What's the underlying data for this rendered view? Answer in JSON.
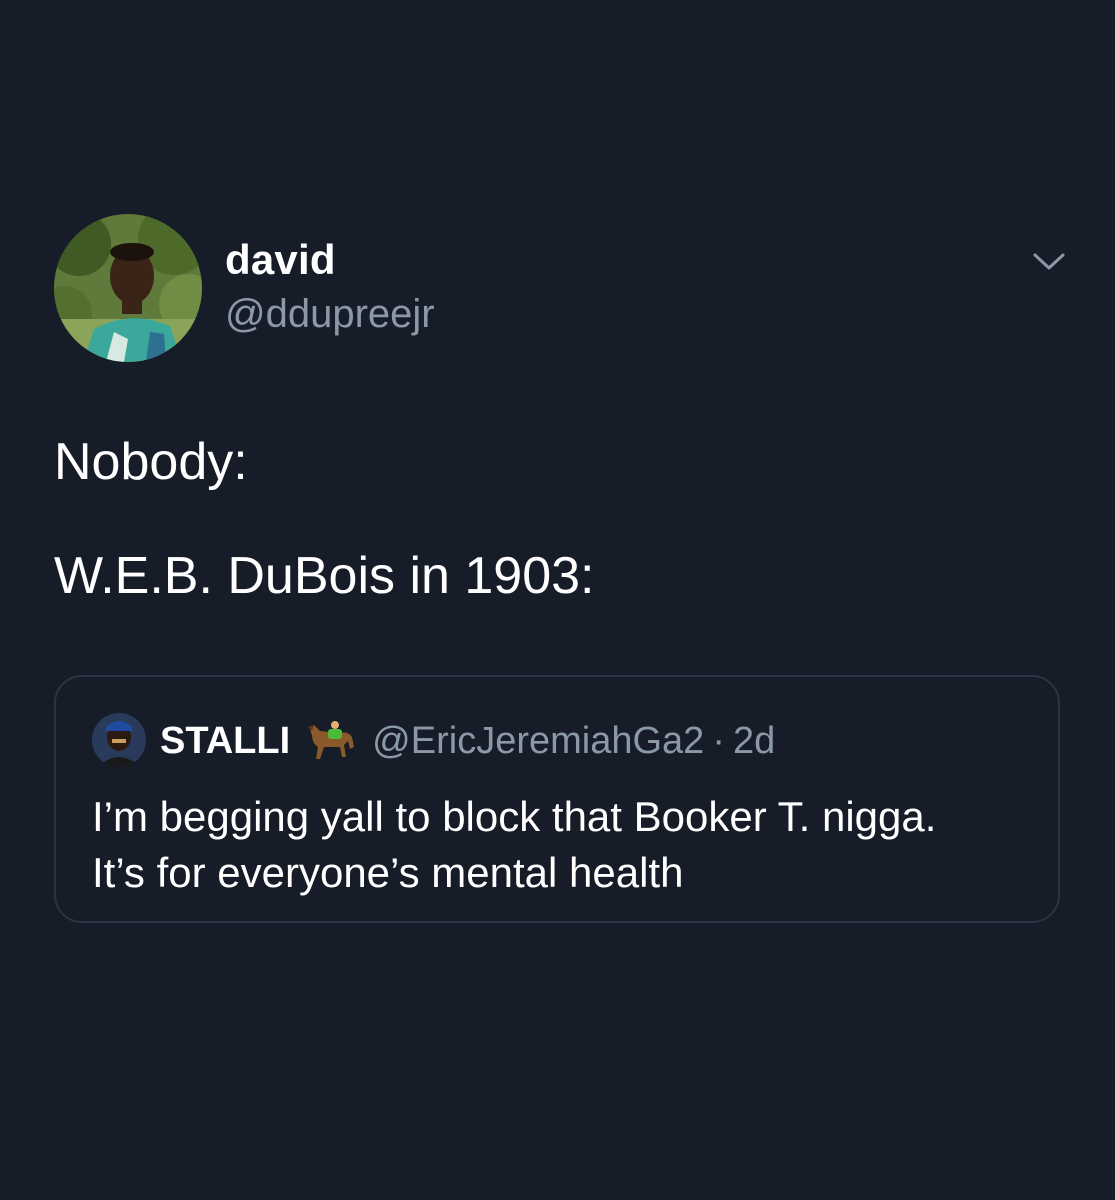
{
  "author": {
    "display_name": "david",
    "handle": "@ddupreejr",
    "avatar_icon": "profile-photo"
  },
  "menu": {
    "icon": "chevron-down-icon"
  },
  "tweet": {
    "lines": [
      "Nobody:",
      "W.E.B. DuBois in 1903:"
    ]
  },
  "quoted_tweet": {
    "display_name": "STALLI",
    "emoji_icon": "horse-racing-icon",
    "handle": "@EricJeremiahGa2",
    "separator": "·",
    "time": "2d",
    "text_lines": [
      "I’m begging yall to block that Booker T. nigga.",
      "It’s for everyone’s mental health"
    ]
  },
  "colors": {
    "background": "#161c28",
    "primary_text": "#ffffff",
    "secondary_text": "#8b98a6",
    "card_border": "#2a3442"
  }
}
